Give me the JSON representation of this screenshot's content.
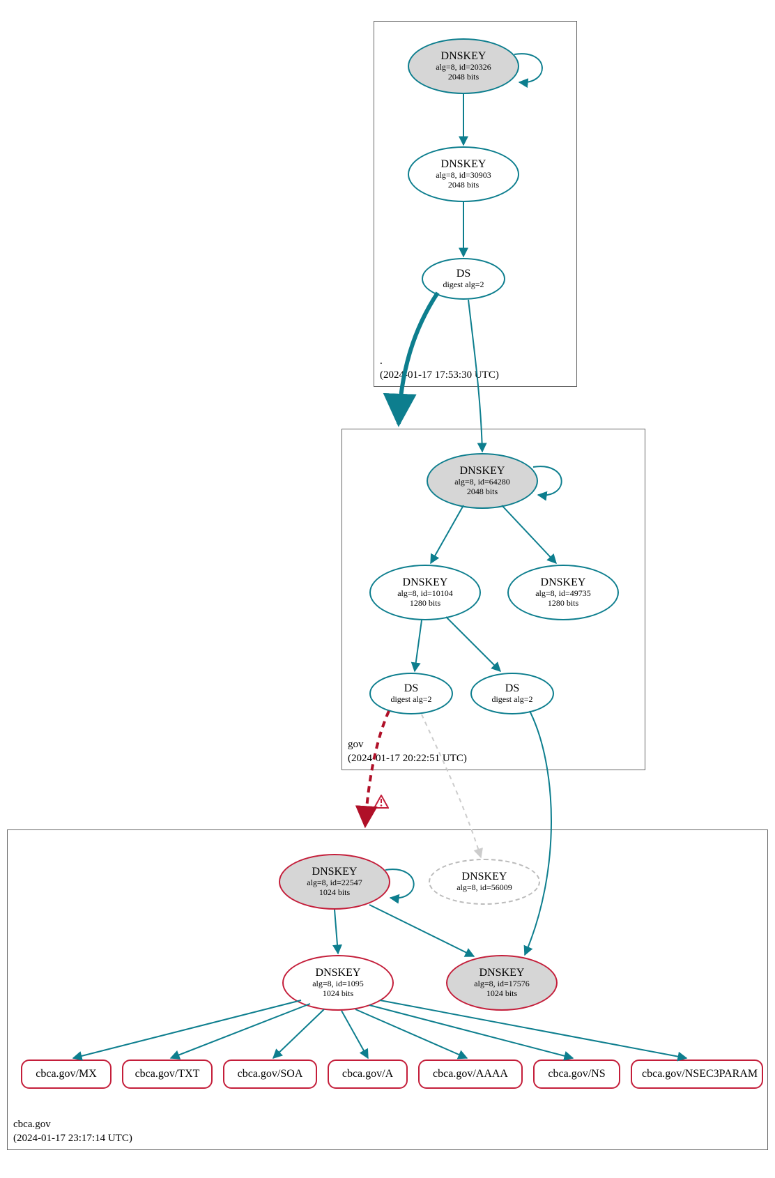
{
  "zones": {
    "root": {
      "name": ".",
      "ts": "(2024-01-17 17:53:30 UTC)"
    },
    "gov": {
      "name": "gov",
      "ts": "(2024-01-17 20:22:51 UTC)"
    },
    "cbca": {
      "name": "cbca.gov",
      "ts": "(2024-01-17 23:17:14 UTC)"
    }
  },
  "nodes": {
    "root_ksk": {
      "title": "DNSKEY",
      "line1": "alg=8, id=20326",
      "line2": "2048 bits"
    },
    "root_zsk": {
      "title": "DNSKEY",
      "line1": "alg=8, id=30903",
      "line2": "2048 bits"
    },
    "root_ds": {
      "title": "DS",
      "line1": "digest alg=2",
      "line2": ""
    },
    "gov_ksk": {
      "title": "DNSKEY",
      "line1": "alg=8, id=64280",
      "line2": "2048 bits"
    },
    "gov_zsk1": {
      "title": "DNSKEY",
      "line1": "alg=8, id=10104",
      "line2": "1280 bits"
    },
    "gov_zsk2": {
      "title": "DNSKEY",
      "line1": "alg=8, id=49735",
      "line2": "1280 bits"
    },
    "gov_ds1": {
      "title": "DS",
      "line1": "digest alg=2",
      "line2": ""
    },
    "gov_ds2": {
      "title": "DS",
      "line1": "digest alg=2",
      "line2": ""
    },
    "cbca_ksk": {
      "title": "DNSKEY",
      "line1": "alg=8, id=22547",
      "line2": "1024 bits"
    },
    "cbca_grey": {
      "title": "DNSKEY",
      "line1": "alg=8, id=56009",
      "line2": ""
    },
    "cbca_zsk": {
      "title": "DNSKEY",
      "line1": "alg=8, id=1095",
      "line2": "1024 bits"
    },
    "cbca_ex": {
      "title": "DNSKEY",
      "line1": "alg=8, id=17576",
      "line2": "1024 bits"
    }
  },
  "rrsets": {
    "mx": "cbca.gov/MX",
    "txt": "cbca.gov/TXT",
    "soa": "cbca.gov/SOA",
    "a": "cbca.gov/A",
    "aaaa": "cbca.gov/AAAA",
    "ns": "cbca.gov/NS",
    "nsec": "cbca.gov/NSEC3PARAM"
  },
  "colors": {
    "teal": "#0d7e8e",
    "red": "#c41e3a",
    "grey": "#bbb",
    "lightgrey": "#ccc"
  }
}
